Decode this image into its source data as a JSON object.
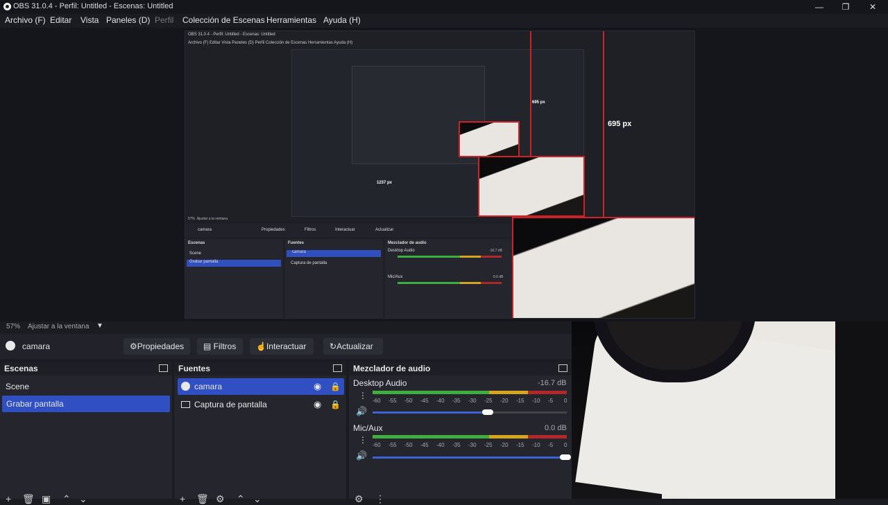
{
  "window": {
    "title": "OBS 31.0.4 - Perfil: Untitled - Escenas: Untitled",
    "controls": [
      "—",
      "❐",
      "✕"
    ]
  },
  "menu": [
    "Archivo (F)",
    "Editar",
    "Vista",
    "Paneles (D)",
    "Perfil",
    "Colección de Escenas",
    "Herramientas",
    "Ayuda (H)"
  ],
  "nested": {
    "title": "OBS 31.0.4 - Perfil: Untitled - Escenas: Untitled",
    "menu": "Archivo (F)   Editar   Vista   Paneles (D)   Perfil   Colección de Escenas   Herramientas   Ayuda (H)",
    "zoom": "57%",
    "zoom_label": "Ajustar a la ventana",
    "source": "camara",
    "buttons": [
      "Propiedades",
      "Filtros",
      "Interactuar",
      "Actualizar"
    ],
    "scenes_title": "Escenas",
    "scenes": [
      "Scene",
      "Grabar pantalla"
    ],
    "sources_title": "Fuentes",
    "sources": [
      "camara",
      "Captura de pantalla"
    ],
    "mixer_title": "Mezclador de audio",
    "desktop": "Desktop Audio",
    "desktop_db": "-16.7 dB",
    "mic": "Mic/Aux",
    "mic_db": "0.0 dB",
    "px_w": "1237 px",
    "px_h": "695 px"
  },
  "status": {
    "zoom": "57%",
    "zoom_label": "Ajustar a la ventana"
  },
  "sourcebar": {
    "source_name": "camara",
    "properties": "Propiedades",
    "filters": "Filtros",
    "interact": "Interactuar",
    "refresh": "Actualizar"
  },
  "scenes": {
    "title": "Escenas",
    "items": [
      "Scene",
      "Grabar pantalla"
    ]
  },
  "sources": {
    "title": "Fuentes",
    "items": [
      "camara",
      "Captura de pantalla"
    ]
  },
  "mixer": {
    "title": "Mezclador de audio",
    "scale": [
      "-60",
      "-55",
      "-50",
      "-45",
      "-40",
      "-35",
      "-30",
      "-25",
      "-20",
      "-15",
      "-10",
      "-5",
      "0"
    ],
    "channels": [
      {
        "name": "Desktop Audio",
        "db": "-16.7 dB",
        "level": 0.6
      },
      {
        "name": "Mic/Aux",
        "db": "0.0 dB",
        "level": 1.0
      }
    ]
  },
  "colors": {
    "accent": "#2f4fc3",
    "red_guides": "#d0202a"
  }
}
